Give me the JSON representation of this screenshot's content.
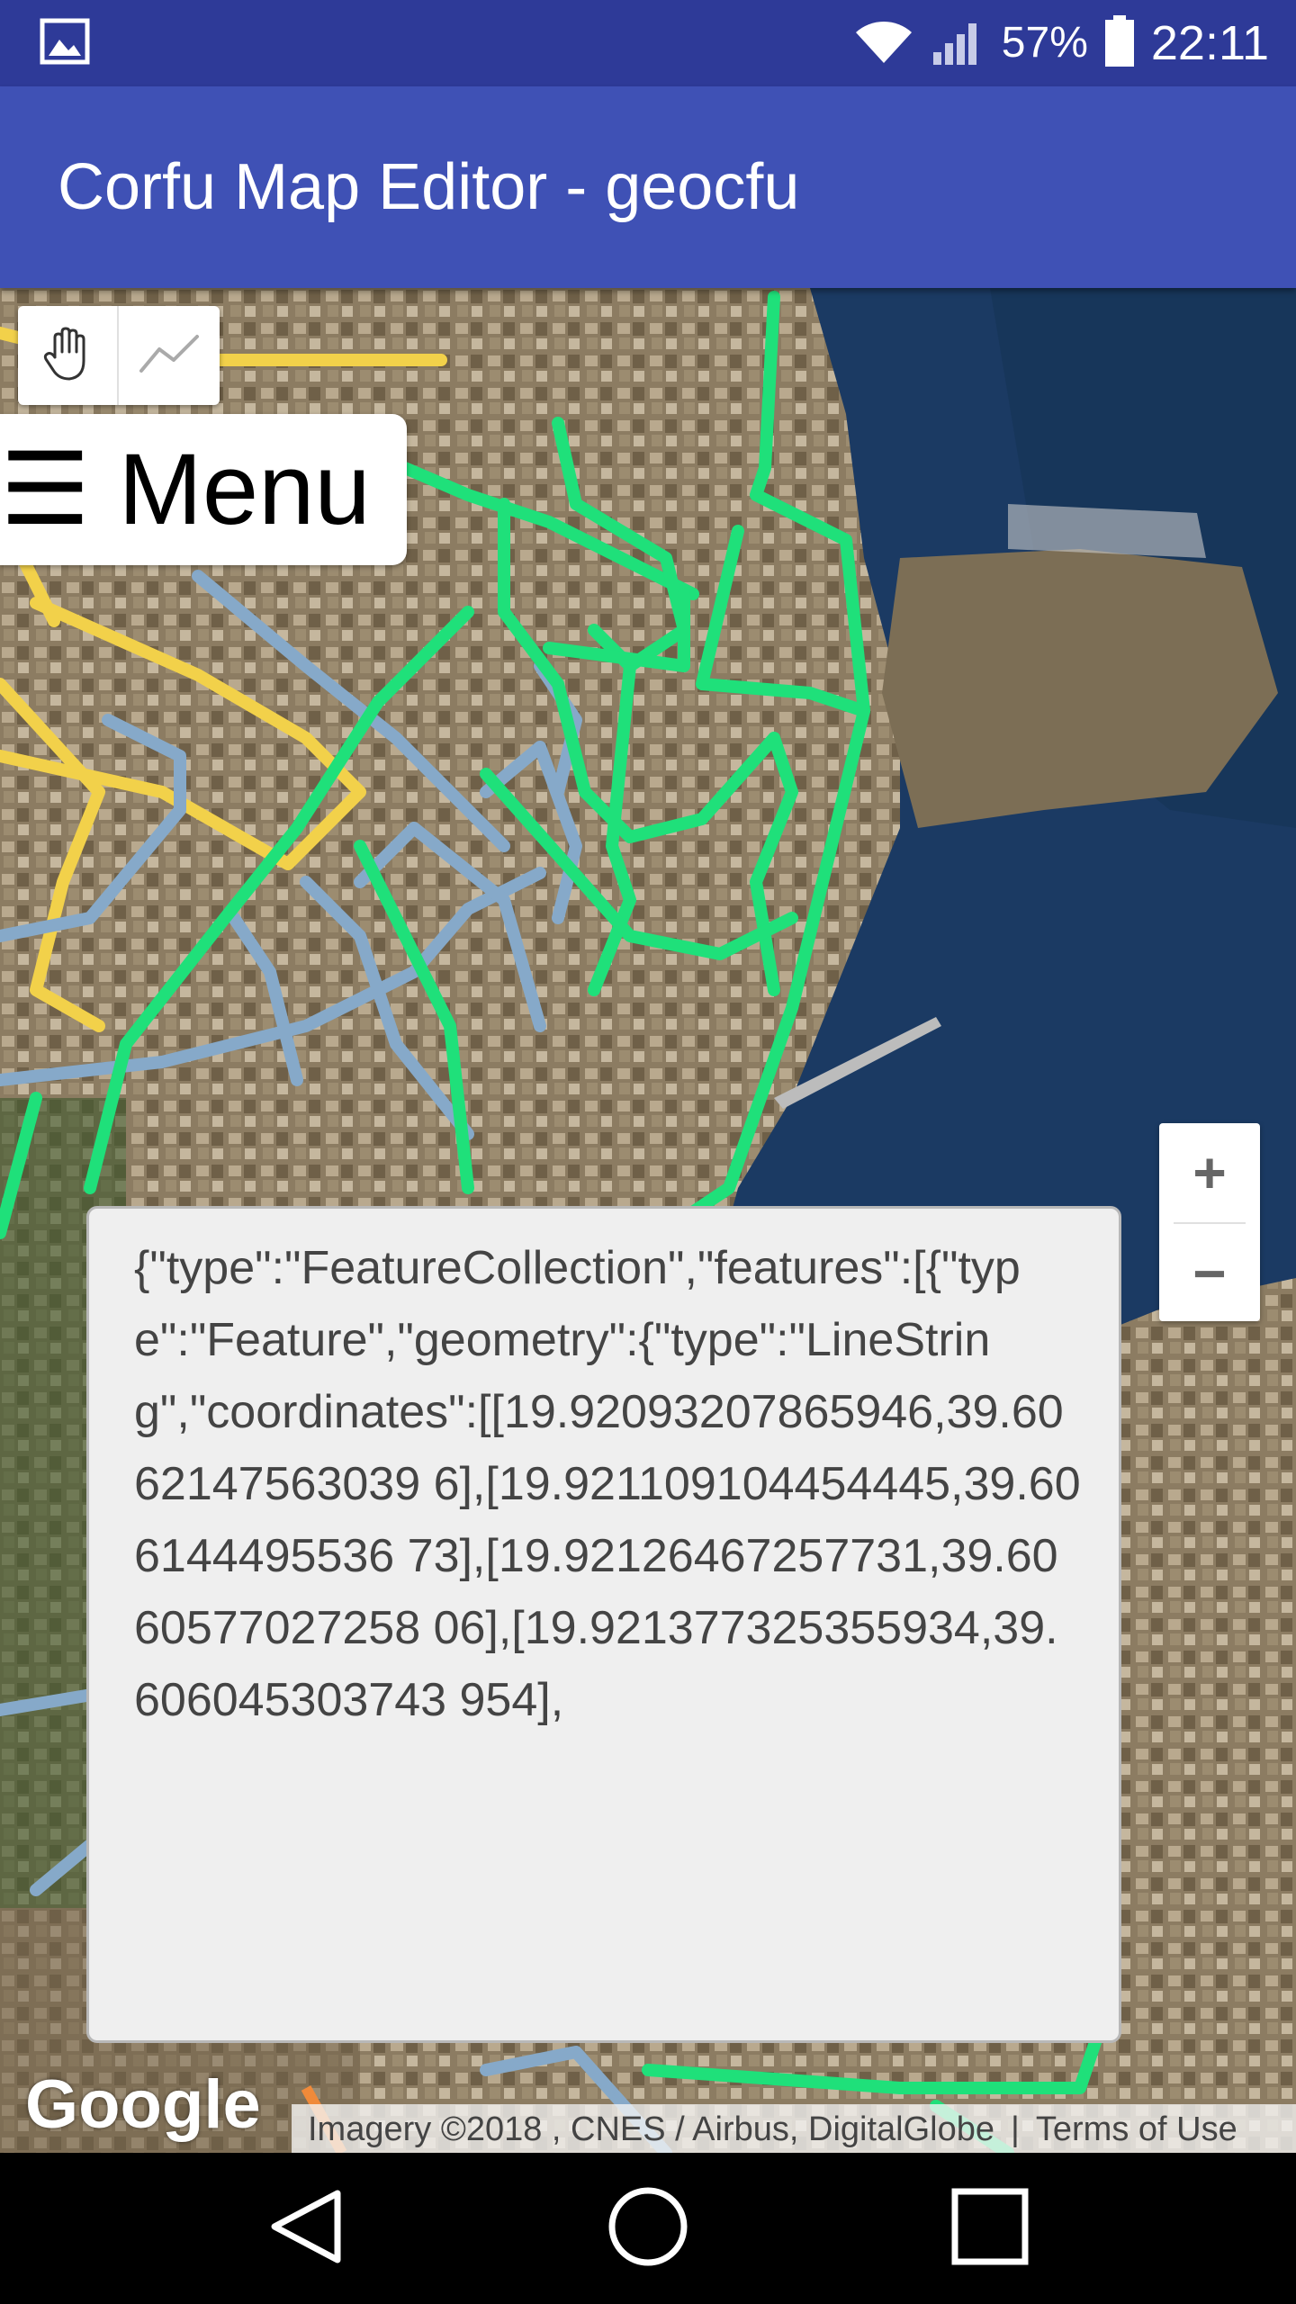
{
  "status_bar": {
    "battery_percent": "57%",
    "time": "22:11",
    "icons": [
      "gallery-icon",
      "wifi-icon",
      "signal-icon",
      "battery-icon"
    ]
  },
  "app_bar": {
    "title": "Corfu Map Editor - geocfu"
  },
  "map": {
    "draw_tools": [
      "pan-hand-icon",
      "draw-line-icon"
    ],
    "menu_label": "☰ Menu",
    "zoom_in": "+",
    "zoom_out": "−",
    "geojson_text": "{\"type\":\"FeatureCollection\",\"features\":[{\"type\":\"Feature\",\"geometry\":{\"type\":\"LineString\",\"coordinates\":[[19.92093207865946,39.6062147563039 6],[19.921109104454445,39.606144495536 73],[19.92126467257731,39.6060577027258 06],[19.921377325355934,39.606045303743 954],",
    "google_logo": "Google",
    "attribution": "Imagery ©2018 , CNES / Airbus, DigitalGlobe",
    "terms": "Terms of Use",
    "colors": {
      "sea": "#1b3a63",
      "land": "#8a7a5e",
      "green_route": "#1fe07a",
      "blue_route": "#86a9c9",
      "yellow_route": "#f2d14a"
    }
  },
  "nav_bar": {
    "buttons": [
      "back-icon",
      "home-icon",
      "recents-icon"
    ]
  }
}
